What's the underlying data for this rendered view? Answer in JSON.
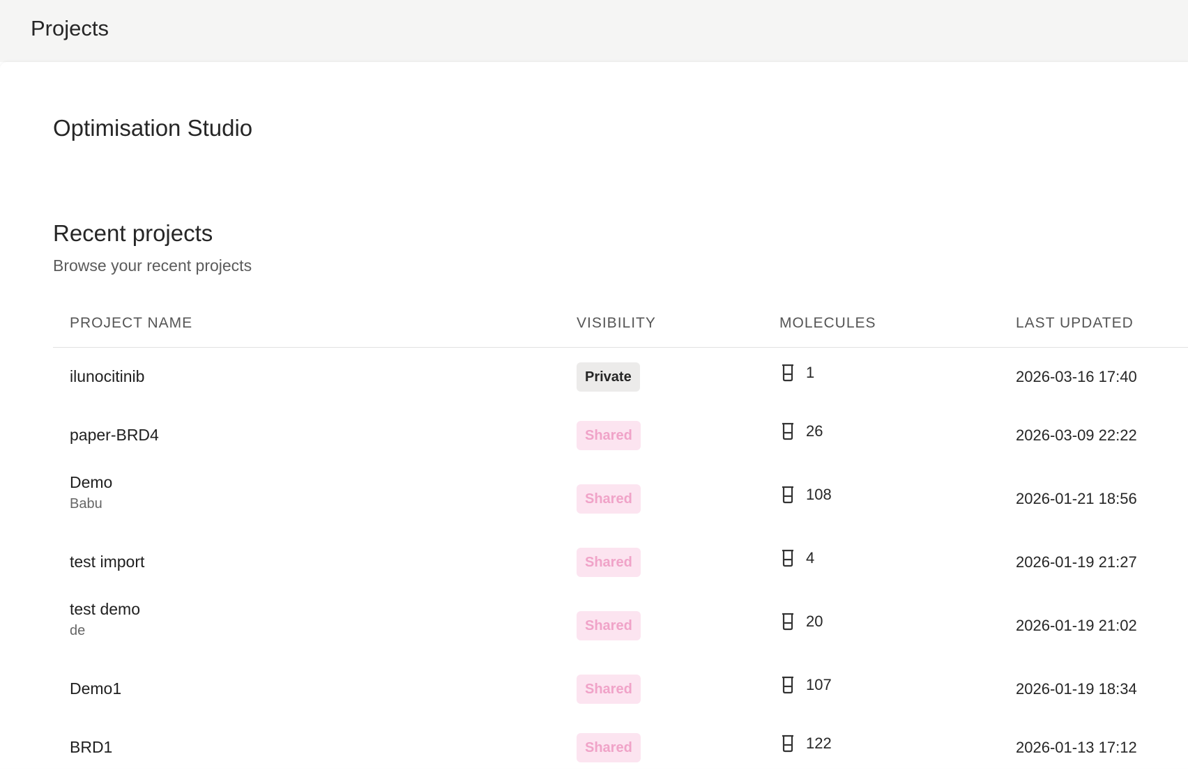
{
  "header": {
    "title": "Projects"
  },
  "studio": {
    "title": "Optimisation Studio"
  },
  "recent": {
    "title": "Recent projects",
    "subtitle": "Browse your recent projects"
  },
  "table": {
    "columns": [
      "PROJECT NAME",
      "VISIBILITY",
      "MOLECULES",
      "LAST UPDATED"
    ],
    "rows": [
      {
        "name": "ilunocitinib",
        "subtitle": "",
        "visibility": "Private",
        "molecules": "1",
        "updated": "2026-03-16 17:40"
      },
      {
        "name": "paper-BRD4",
        "subtitle": "",
        "visibility": "Shared",
        "molecules": "26",
        "updated": "2026-03-09 22:22"
      },
      {
        "name": "Demo",
        "subtitle": "Babu",
        "visibility": "Shared",
        "molecules": "108",
        "updated": "2026-01-21 18:56"
      },
      {
        "name": "test import",
        "subtitle": "",
        "visibility": "Shared",
        "molecules": "4",
        "updated": "2026-01-19 21:27"
      },
      {
        "name": "test demo",
        "subtitle": "de",
        "visibility": "Shared",
        "molecules": "20",
        "updated": "2026-01-19 21:02"
      },
      {
        "name": "Demo1",
        "subtitle": "",
        "visibility": "Shared",
        "molecules": "107",
        "updated": "2026-01-19 18:34"
      },
      {
        "name": "BRD1",
        "subtitle": "",
        "visibility": "Shared",
        "molecules": "122",
        "updated": "2026-01-13 17:12"
      }
    ]
  },
  "icons": {
    "molecules": "beaker-icon"
  },
  "colors": {
    "header_bg": "#f5f5f4",
    "private_badge_bg": "#ecebea",
    "shared_badge_bg": "#fce4f0",
    "shared_badge_text": "#f0a3c8"
  }
}
